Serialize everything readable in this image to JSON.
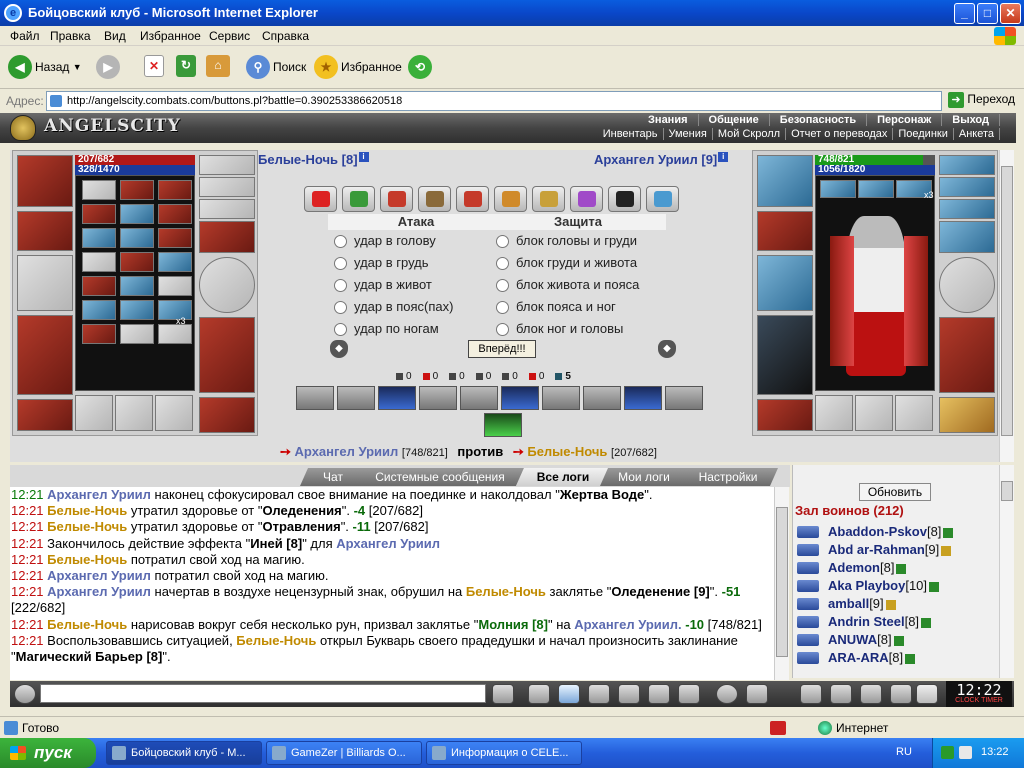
{
  "window": {
    "title": "Бойцовский клуб - Microsoft Internet Explorer",
    "icon": "ie-icon",
    "controls": {
      "minimize": "_",
      "maximize": "□",
      "close": "✕"
    }
  },
  "menu": [
    "Файл",
    "Правка",
    "Вид",
    "Избранное",
    "Сервис",
    "Справка"
  ],
  "toolbar": {
    "back": "Назад",
    "search": "Поиск",
    "favorites": "Избранное"
  },
  "address": {
    "label": "Адрес:",
    "url": "http://angelscity.combats.com/buttons.pl?battle=0.390253386620518",
    "go": "Переход"
  },
  "game": {
    "logo": "ANGELSCITY",
    "top_menu": [
      "Знания",
      "Общение",
      "Безопасность",
      "Персонаж",
      "Выход"
    ],
    "sub_menu": [
      "Инвентарь",
      "Умения",
      "Мой Скролл",
      "Отчет о переводах",
      "Поединки",
      "Анкета"
    ],
    "left_fighter": {
      "name": "Белые-Ночь [8]",
      "hp": "207/682",
      "mp": "328/1470"
    },
    "right_fighter": {
      "name": "Архангел Уриил [9]",
      "hp": "748/821",
      "mp": "1056/1820"
    },
    "attack_header": "Атака",
    "defense_header": "Защита",
    "attack_options": [
      "удар в голову",
      "удар в грудь",
      "удар в живот",
      "удар в пояс(пах)",
      "удар по ногам"
    ],
    "defense_options": [
      "блок головы и груди",
      "блок груди и живота",
      "блок живота и пояса",
      "блок пояса и ног",
      "блок ног и головы"
    ],
    "forward_button": "Вперёд!!!",
    "stats": [
      "0",
      "0",
      "0",
      "0",
      "0",
      "0",
      "5"
    ],
    "versus": {
      "left_name": "Архангел Уриил",
      "left_hp": "[748/821]",
      "vs": "против",
      "right_name": "Белые-Ночь",
      "right_hp": "[207/682]"
    },
    "slot_count": "x3"
  },
  "chat_tabs": [
    "Чат",
    "Системные сообщения",
    "Все логи",
    "Мои логи",
    "Настройки"
  ],
  "log": {
    "time": "12:21",
    "lines": [
      {
        "a": "Архангел Уриил",
        "t1": " наконец сфокусировал свое внимание на поединке и наколдовал \"",
        "b": "Жертва Воде",
        "t2": "\"."
      },
      {
        "a": "Белые-Ночь",
        "t1": " утратил здоровье от \"",
        "b": "Оледенения",
        "t2": "\". ",
        "d": "-4",
        "t3": " [207/682]"
      },
      {
        "a": "Белые-Ночь",
        "t1": " утратил здоровье от \"",
        "b": "Отравления",
        "t2": "\". ",
        "d": "-11",
        "t3": " [207/682]"
      },
      {
        "t0": " Закончилось действие эффекта \"",
        "b": "Иней [8]",
        "t1": "\" для ",
        "a": "Архангел Уриил"
      },
      {
        "a": "Белые-Ночь",
        "t1": " потратил свой ход на магию."
      },
      {
        "a": "Архангел Уриил",
        "t1": " потратил свой ход на магию."
      },
      {
        "a": "Архангел Уриил",
        "t1": " начертав в воздухе нецензурный знак, обрушил на ",
        "a2": "Белые-Ночь",
        "t2": " заклятье \"",
        "b": "Оледенение [9]",
        "t3": "\". ",
        "d": "-51",
        "t4": " [222/682]"
      },
      {
        "a": "Белые-Ночь",
        "t1": " нарисовав вокруг себя несколько рун, призвал заклятье \"",
        "g": "Молния [8]",
        "t2": "\" на ",
        "a2": "Архангел Уриил.",
        "t3": " ",
        "d": "-10",
        "t4": " [748/821]"
      },
      {
        "t0": " Воспользовавшись ситуацией, ",
        "a": "Белые-Ночь",
        "t1": " открыл Букварь своего прадедушки и начал произносить заклинание \"",
        "b": "Магический Барьер [8]",
        "t2": "\"."
      }
    ]
  },
  "hall": {
    "refresh": "Обновить",
    "header": "Зал воинов (212)",
    "users": [
      {
        "name": "Abaddon-Pskov",
        "lv": "[8]"
      },
      {
        "name": "Abd ar-Rahman",
        "lv": "[9]"
      },
      {
        "name": "Ademon",
        "lv": "[8]"
      },
      {
        "name": "Aka Playboy",
        "lv": "[10]"
      },
      {
        "name": "amball",
        "lv": "[9]"
      },
      {
        "name": "Andrin Steel",
        "lv": "[8]"
      },
      {
        "name": "ANUWA",
        "lv": "[8]"
      },
      {
        "name": "ARA-ARA",
        "lv": "[8]"
      }
    ]
  },
  "clock": {
    "time": "12:22",
    "label": "CLOCK  TIMER"
  },
  "status": {
    "ready": "Готово",
    "zone": "Интернет"
  },
  "taskbar": {
    "start": "пуск",
    "tasks": [
      "Бойцовский клуб - М...",
      "GameZer | Billiards O...",
      "Информация о CELE..."
    ],
    "lang": "RU",
    "time": "13:22"
  }
}
